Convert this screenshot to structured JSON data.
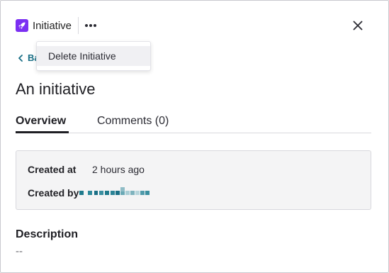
{
  "header": {
    "type_label": "Initiative",
    "type_icon": "rocket-icon",
    "accent_color": "#7b2ff2",
    "more_icon": "more-horizontal-icon",
    "close_icon": "close-icon"
  },
  "back": {
    "label": "Ba",
    "icon": "chevron-left-icon",
    "color": "#1a6f86"
  },
  "menu": {
    "items": [
      {
        "label": "Delete Initiative"
      }
    ]
  },
  "page": {
    "title": "An initiative"
  },
  "tabs": [
    {
      "label": "Overview",
      "active": true
    },
    {
      "label": "Comments (0)",
      "active": false
    }
  ],
  "meta": {
    "created_at_label": "Created at",
    "created_at_value": "2 hours ago",
    "created_by_label": "Created by"
  },
  "description": {
    "title": "Description",
    "value": "--"
  }
}
